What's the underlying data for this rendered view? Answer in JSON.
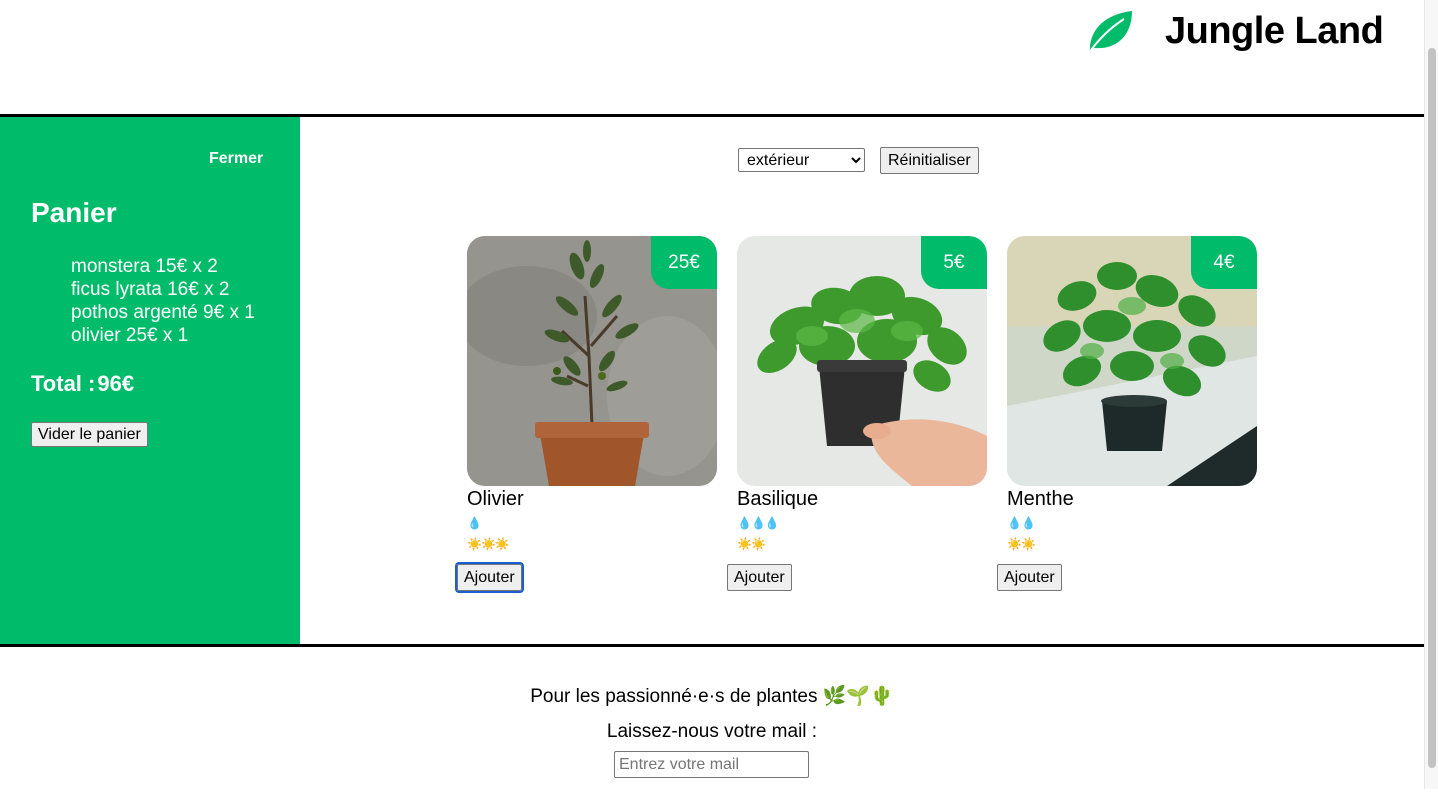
{
  "header": {
    "brand": "Jungle Land",
    "logo_icon": "leaf-icon"
  },
  "cart": {
    "close_label": "Fermer",
    "title": "Panier",
    "items": [
      "monstera 15€ x 2",
      "ficus lyrata 16€ x 2",
      "pothos argenté 9€ x 1",
      "olivier 25€ x 1"
    ],
    "total_label": "Total :",
    "total_value": "96€",
    "empty_label": "Vider le panier"
  },
  "filter": {
    "selected_category": "extérieur",
    "reset_label": "Réinitialiser"
  },
  "plants": [
    {
      "name": "Olivier",
      "price": "25€",
      "water": "💧",
      "light": "☀️☀️☀️",
      "add_label": "Ajouter"
    },
    {
      "name": "Basilique",
      "price": "5€",
      "water": "💧💧💧",
      "light": "☀️☀️",
      "add_label": "Ajouter"
    },
    {
      "name": "Menthe",
      "price": "4€",
      "water": "💧💧",
      "light": "☀️☀️",
      "add_label": "Ajouter"
    }
  ],
  "footer": {
    "tagline": "Pour les passionné·e·s de plantes 🌿🌱🌵",
    "mail_label": "Laissez-nous votre mail :",
    "mail_placeholder": "Entrez votre mail"
  },
  "colors": {
    "accent": "#00BB6A"
  }
}
